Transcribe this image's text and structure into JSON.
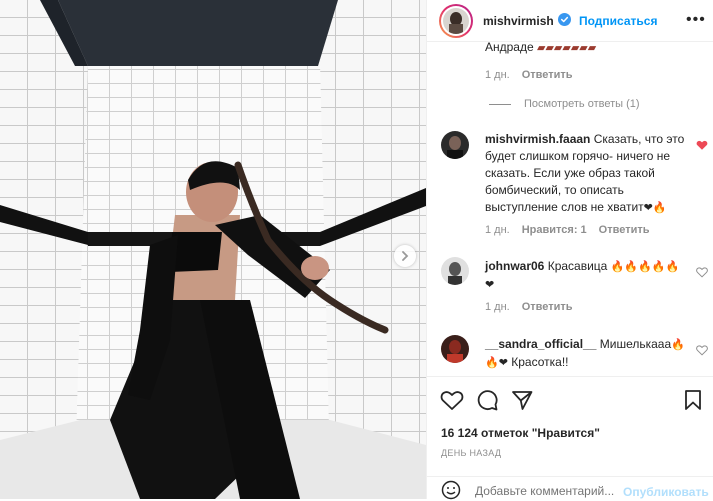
{
  "header": {
    "username": "mishvirmish",
    "follow_label": "Подписаться",
    "more_label": "•••"
  },
  "comments_panel": {
    "cut_text": "Андраде",
    "cut_meta": {
      "time": "1 дн.",
      "reply": "Ответить"
    },
    "view_replies": "Посмотреть ответы (1)",
    "comments": [
      {
        "username": "mishvirmish.faaan",
        "text": "Сказать, что это будет слишком горячо- ничего не сказать. Если уже образ такой бомбический, то описать выступление слов не хватит",
        "emoji": "❤🔥",
        "time": "1 дн.",
        "likes": "Нравится: 1",
        "reply": "Ответить",
        "liked": true
      },
      {
        "username": "johnwar06",
        "text": "Красавица",
        "emoji": "🔥🔥🔥🔥🔥❤",
        "time": "1 дн.",
        "reply": "Ответить",
        "liked": false
      },
      {
        "username": "__sandra_official__",
        "text": "Мишелькааа",
        "emoji": "🔥🔥❤",
        "text_after": "Красотка!!",
        "liked": false
      }
    ]
  },
  "post": {
    "likes": "16 124 отметок \"Нравится\"",
    "date": "ДЕНЬ НАЗАД",
    "add_comment_placeholder": "Добавьте комментарий...",
    "publish_label": "Опубликовать"
  },
  "colors": {
    "link_blue": "#0095f6",
    "like_red": "#ed4956",
    "muted": "#8e8e8e",
    "text": "#262626",
    "publish_disabled": "#b2dffc"
  }
}
